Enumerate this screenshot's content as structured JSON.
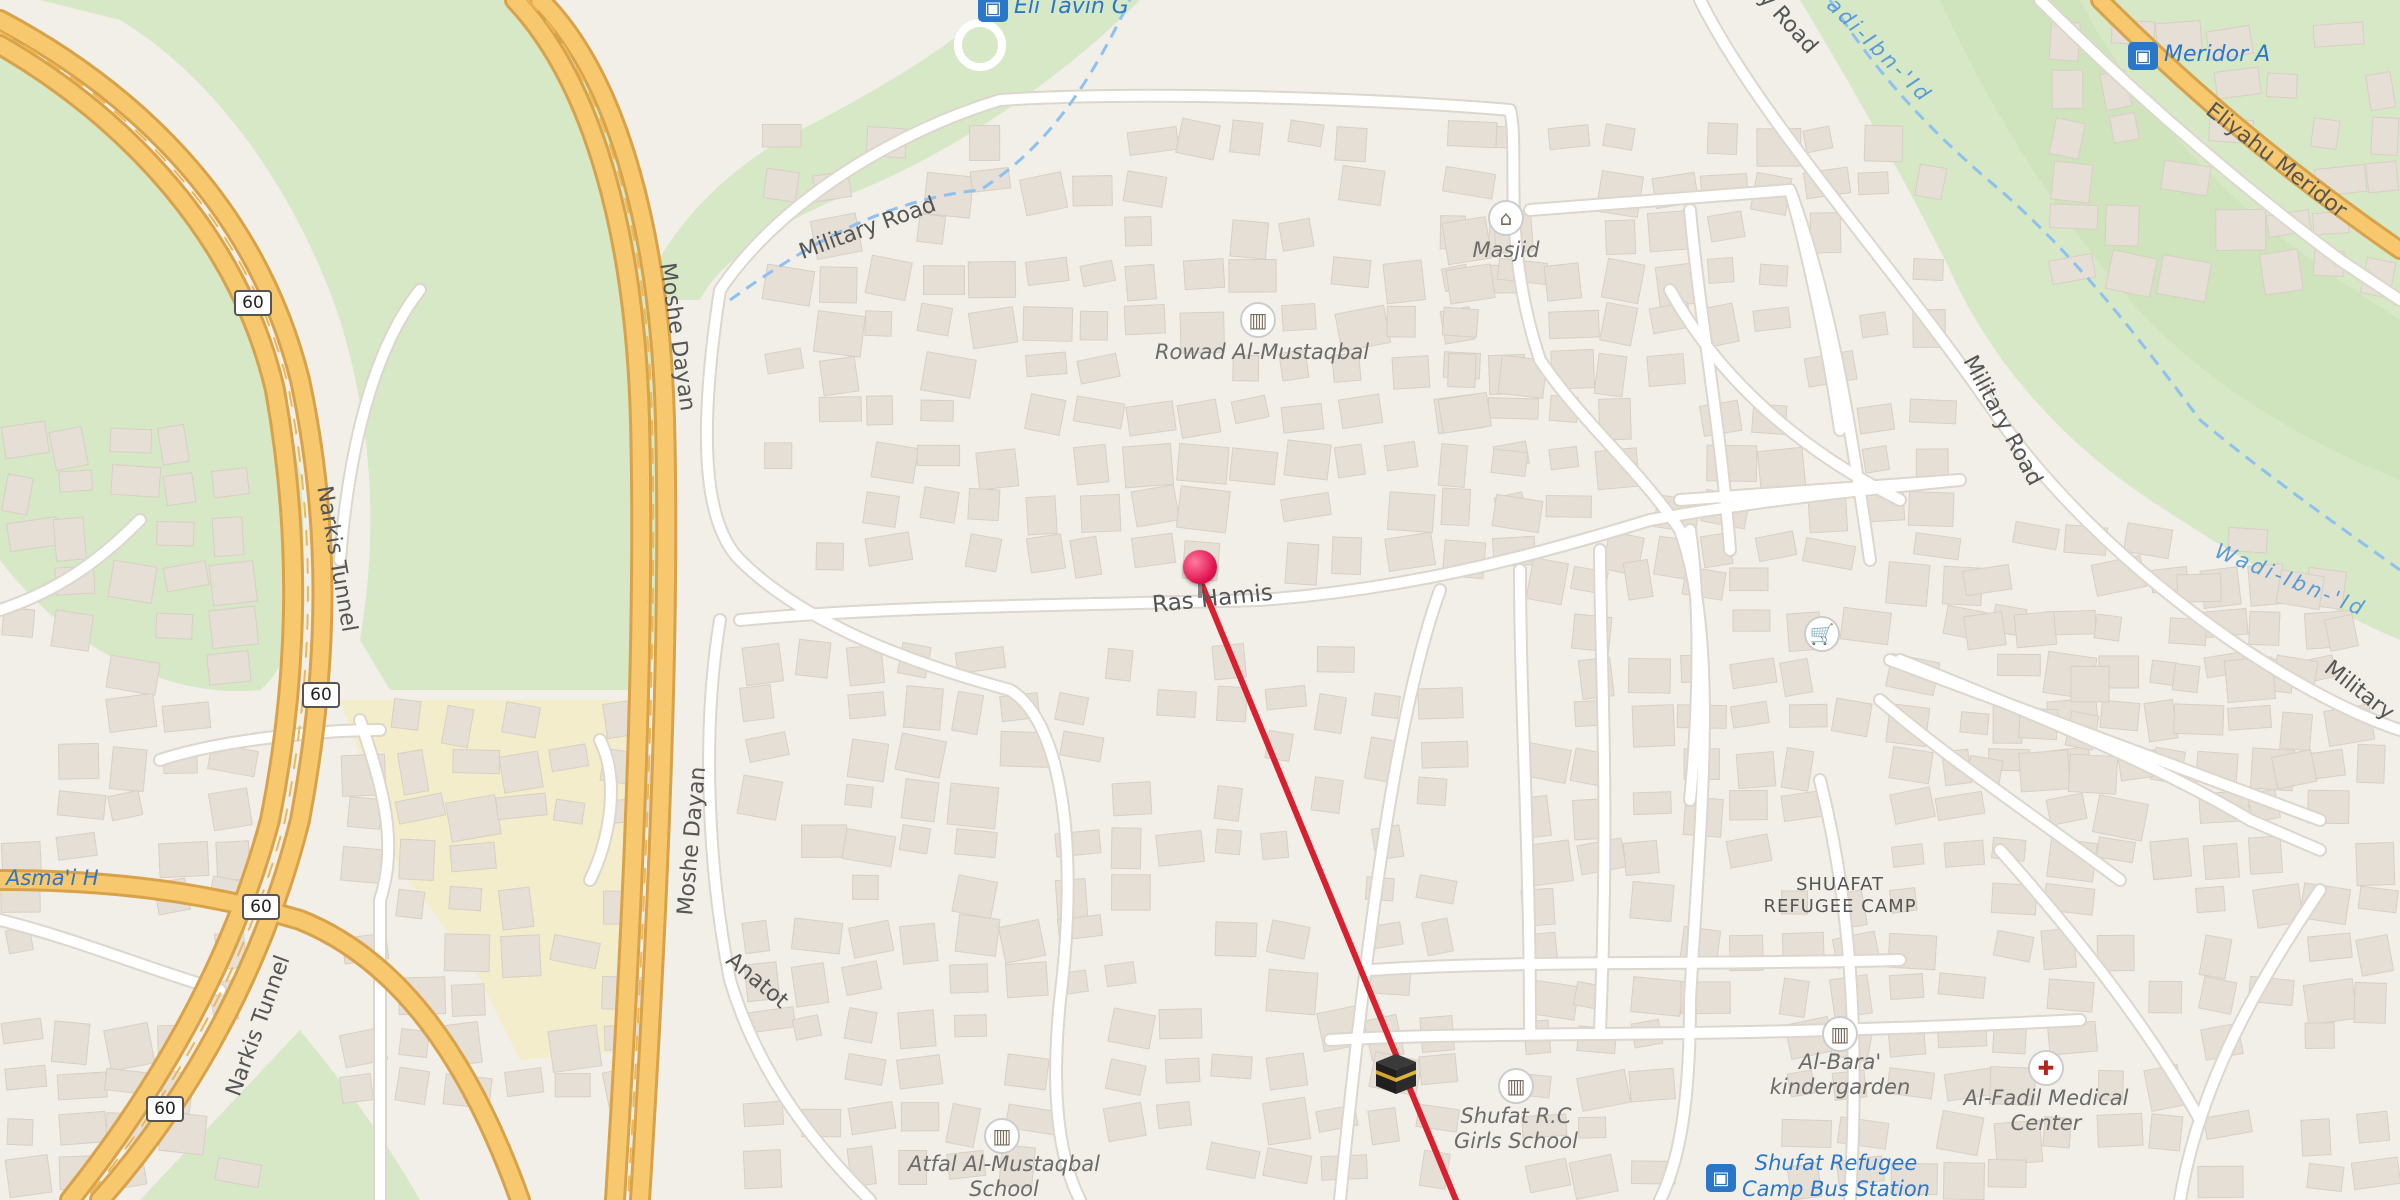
{
  "map": {
    "colors": {
      "background": "#f2efe9",
      "park": "#d6e8c5",
      "highway": "#f7c86d",
      "highway_casing": "#d8a24a",
      "road": "#ffffff",
      "road_casing": "#dcd6cc",
      "building": "#e6dfd6",
      "industrial": "#f4edcc",
      "route_line": "#d9202e",
      "water_line": "#8ec1ef"
    },
    "streets": {
      "military_road_1": "Military Road",
      "military_road_2": "Military Road",
      "military_road_top": "y Road",
      "military_road_right": "Military",
      "moshe_dayan_1": "Moshe Dayan",
      "moshe_dayan_2": "Moshe Dayan",
      "narkis_tunnel_1": "Narkis Tunnel",
      "narkis_tunnel_2": "Narkis Tunnel",
      "ras_hamis": "Ras Hamis",
      "anatot": "Anatot",
      "asmai": "Asma'i H",
      "eliyahu_meridor": "Eliyahu Meridor"
    },
    "waterways": {
      "wadi_top": "adi-Ibn-'Id",
      "wadi_right": "Wadi-Ibn-'Id"
    },
    "route_shields": [
      "60",
      "60",
      "60",
      "60"
    ],
    "pois": {
      "eli_tavin": "Eli Tavin G",
      "meridor": "Meridor A",
      "masjid": "Masjid",
      "rowad": "Rowad Al-Mustaqbal",
      "al_bara_line1": "Al-Bara'",
      "al_bara_line2": "kindergarden",
      "shufat_school_line1": "Shufat R.C",
      "shufat_school_line2": "Girls School",
      "al_fadil_line1": "Al-Fadil Medical",
      "al_fadil_line2": "Center",
      "atfal_line1": "Atfal Al-Mustaqbal",
      "atfal_line2": "School",
      "bus_station_line1": "Shufat Refugee",
      "bus_station_line2": "Camp Bus Station",
      "camp_line1": "SHUAFAT",
      "camp_line2": "REFUGEE CAMP"
    },
    "icons": [
      "bus-stop-icon",
      "mosque-icon",
      "school-icon",
      "shop-icon",
      "hospital-icon",
      "kaaba-icon",
      "location-pin-icon"
    ]
  }
}
